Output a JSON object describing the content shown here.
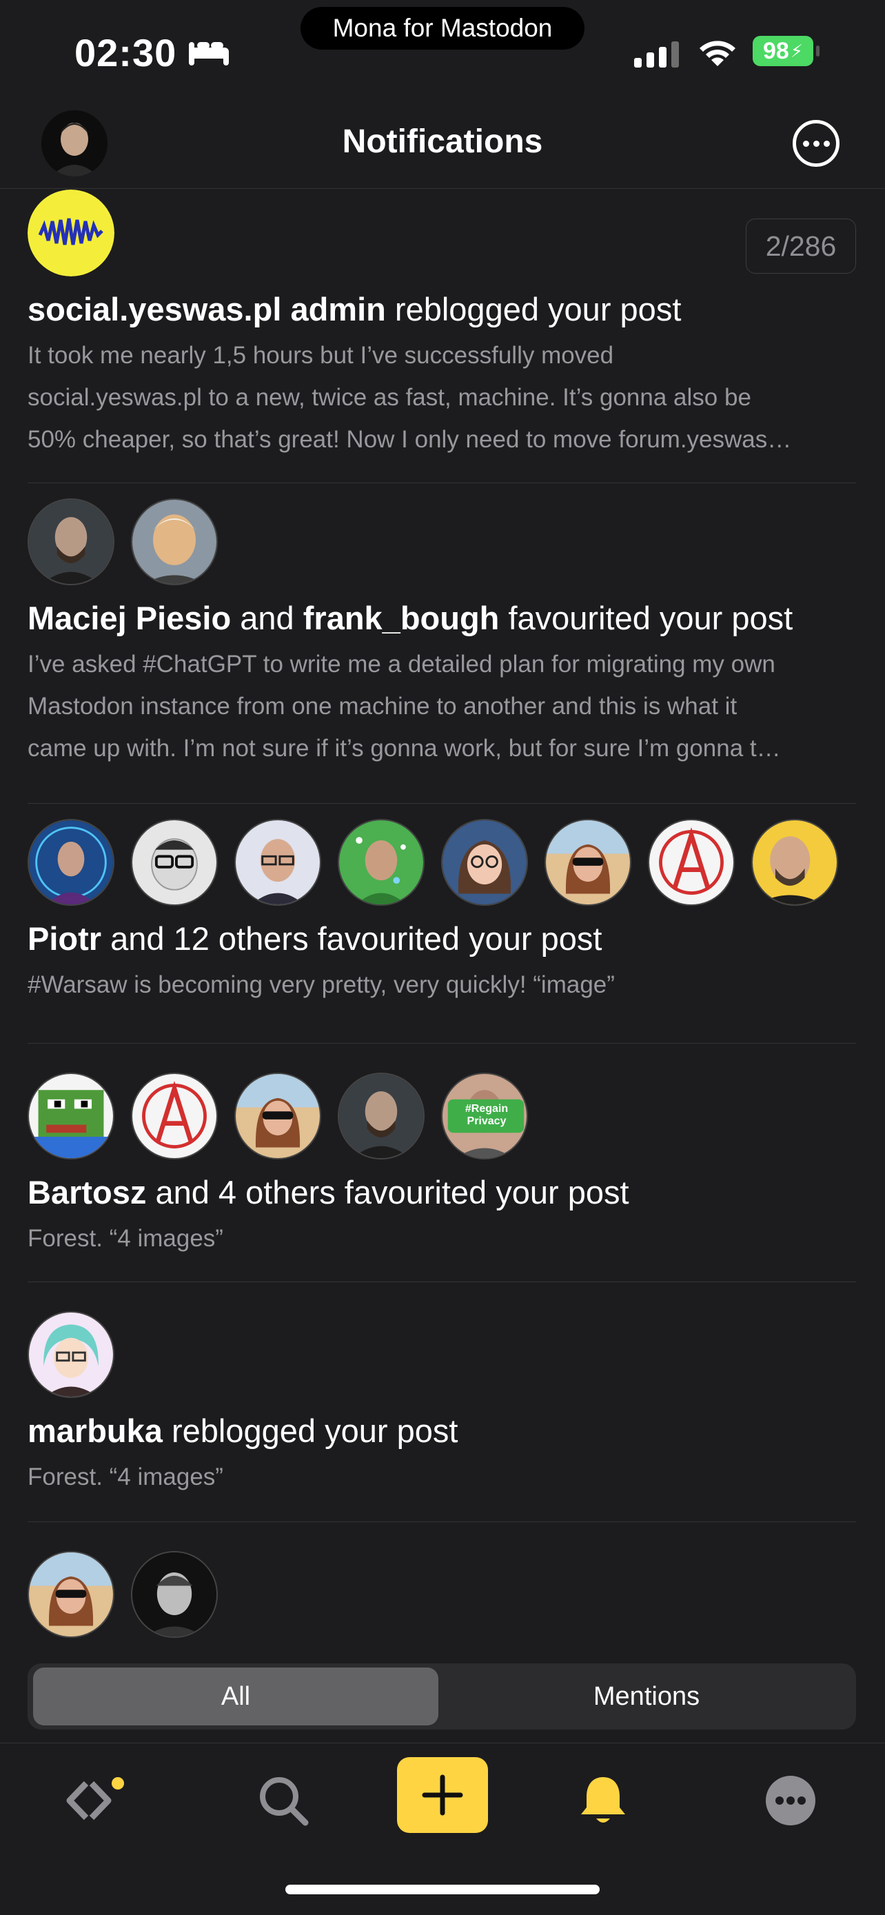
{
  "status": {
    "time": "02:30",
    "app_pill": "Mona for Mastodon",
    "battery": "98"
  },
  "nav": {
    "title": "Notifications"
  },
  "notifications": [
    {
      "counter": "2/286",
      "actors": [
        "social.yeswas.pl admin"
      ],
      "action": "reblogged your post",
      "body": [
        "It took me nearly 1,5 hours but I’ve successfully moved",
        "social.yeswas.pl to a new, twice as fast, machine. It’s gonna also be",
        "50% cheaper, so that’s great! Now I only need to move forum.yeswas…"
      ]
    },
    {
      "actor1": "Maciej Piesio",
      "conj": "and",
      "actor2": "frank_bough",
      "action": "favourited your post",
      "body": [
        "I’ve asked #ChatGPT to write me a detailed plan for migrating my own",
        "Mastodon instance from one machine to another and this is what it",
        "came up with. I’m not sure if it’s gonna work, but for sure I’m gonna t…"
      ]
    },
    {
      "actor1": "Piotr",
      "rest": "and 12 others favourited your post",
      "body": [
        "#Warsaw is becoming very pretty, very quickly! “image”"
      ]
    },
    {
      "actor1": "Bartosz",
      "rest": "and 4 others favourited your post",
      "body": [
        "Forest. “4 images”"
      ]
    },
    {
      "actor1": "marbuka",
      "rest": "reblogged your post",
      "body": [
        "Forest. “4 images”"
      ]
    }
  ],
  "privacy_badge": "#Regain Privacy",
  "segments": {
    "all": "All",
    "mentions": "Mentions",
    "selected": "All"
  },
  "tabs": [
    "timeline-icon",
    "search-icon",
    "compose-icon",
    "bell-icon",
    "more-icon"
  ],
  "colors": {
    "background": "#1c1c1e",
    "accent": "#fed443",
    "secondary_text": "#98989d",
    "battery": "#4cd964"
  }
}
